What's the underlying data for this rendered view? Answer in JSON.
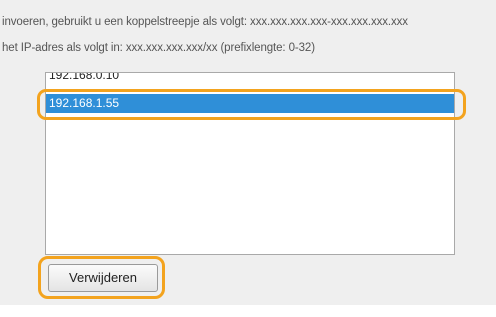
{
  "instructions": {
    "line1": "invoeren, gebruikt u een koppelstreepje als volgt: xxx.xxx.xxx.xxx-xxx.xxx.xxx.xxx",
    "line2": "het IP-adres als volgt in: xxx.xxx.xxx.xxx/xx (prefixlengte: 0-32)"
  },
  "address_list": {
    "items": [
      {
        "label": "192.168.0.10",
        "selected": false
      },
      {
        "label": "192.168.1.55",
        "selected": true
      }
    ]
  },
  "remove_button": {
    "label": "Verwijderen"
  },
  "colors": {
    "selection": "#2f8fd8",
    "highlight": "#f3a31e",
    "panel_background": "#efefef"
  }
}
